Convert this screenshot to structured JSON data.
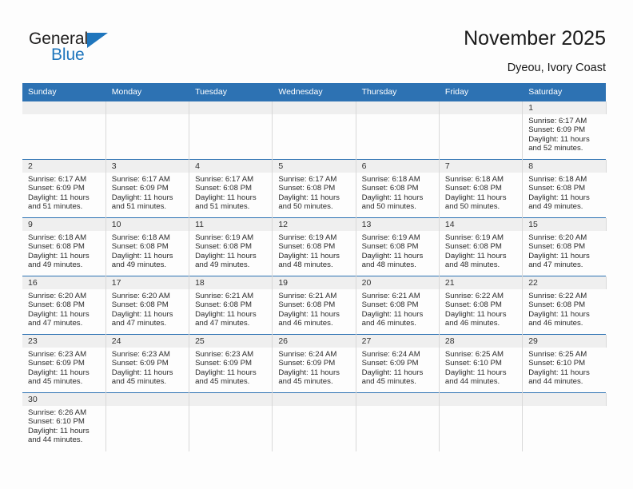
{
  "brand": {
    "name_part1": "General",
    "name_part2": "Blue",
    "accent_color": "#1f76bd",
    "triangle_icon": "logo-triangle-icon"
  },
  "header": {
    "title": "November 2025",
    "subtitle": "Dyeou, Ivory Coast"
  },
  "calendar": {
    "header_bg": "#2d72b3",
    "daynum_bg": "#efefef",
    "weekdays": [
      "Sunday",
      "Monday",
      "Tuesday",
      "Wednesday",
      "Thursday",
      "Friday",
      "Saturday"
    ],
    "labels": {
      "sunrise": "Sunrise:",
      "sunset": "Sunset:",
      "daylight": "Daylight:"
    },
    "weeks": [
      [
        {
          "day": "",
          "empty": true
        },
        {
          "day": "",
          "empty": true
        },
        {
          "day": "",
          "empty": true
        },
        {
          "day": "",
          "empty": true
        },
        {
          "day": "",
          "empty": true
        },
        {
          "day": "",
          "empty": true
        },
        {
          "day": "1",
          "sunrise": "Sunrise: 6:17 AM",
          "sunset": "Sunset: 6:09 PM",
          "daylight_l1": "Daylight: 11 hours",
          "daylight_l2": "and 52 minutes."
        }
      ],
      [
        {
          "day": "2",
          "sunrise": "Sunrise: 6:17 AM",
          "sunset": "Sunset: 6:09 PM",
          "daylight_l1": "Daylight: 11 hours",
          "daylight_l2": "and 51 minutes."
        },
        {
          "day": "3",
          "sunrise": "Sunrise: 6:17 AM",
          "sunset": "Sunset: 6:09 PM",
          "daylight_l1": "Daylight: 11 hours",
          "daylight_l2": "and 51 minutes."
        },
        {
          "day": "4",
          "sunrise": "Sunrise: 6:17 AM",
          "sunset": "Sunset: 6:08 PM",
          "daylight_l1": "Daylight: 11 hours",
          "daylight_l2": "and 51 minutes."
        },
        {
          "day": "5",
          "sunrise": "Sunrise: 6:17 AM",
          "sunset": "Sunset: 6:08 PM",
          "daylight_l1": "Daylight: 11 hours",
          "daylight_l2": "and 50 minutes."
        },
        {
          "day": "6",
          "sunrise": "Sunrise: 6:18 AM",
          "sunset": "Sunset: 6:08 PM",
          "daylight_l1": "Daylight: 11 hours",
          "daylight_l2": "and 50 minutes."
        },
        {
          "day": "7",
          "sunrise": "Sunrise: 6:18 AM",
          "sunset": "Sunset: 6:08 PM",
          "daylight_l1": "Daylight: 11 hours",
          "daylight_l2": "and 50 minutes."
        },
        {
          "day": "8",
          "sunrise": "Sunrise: 6:18 AM",
          "sunset": "Sunset: 6:08 PM",
          "daylight_l1": "Daylight: 11 hours",
          "daylight_l2": "and 49 minutes."
        }
      ],
      [
        {
          "day": "9",
          "sunrise": "Sunrise: 6:18 AM",
          "sunset": "Sunset: 6:08 PM",
          "daylight_l1": "Daylight: 11 hours",
          "daylight_l2": "and 49 minutes."
        },
        {
          "day": "10",
          "sunrise": "Sunrise: 6:18 AM",
          "sunset": "Sunset: 6:08 PM",
          "daylight_l1": "Daylight: 11 hours",
          "daylight_l2": "and 49 minutes."
        },
        {
          "day": "11",
          "sunrise": "Sunrise: 6:19 AM",
          "sunset": "Sunset: 6:08 PM",
          "daylight_l1": "Daylight: 11 hours",
          "daylight_l2": "and 49 minutes."
        },
        {
          "day": "12",
          "sunrise": "Sunrise: 6:19 AM",
          "sunset": "Sunset: 6:08 PM",
          "daylight_l1": "Daylight: 11 hours",
          "daylight_l2": "and 48 minutes."
        },
        {
          "day": "13",
          "sunrise": "Sunrise: 6:19 AM",
          "sunset": "Sunset: 6:08 PM",
          "daylight_l1": "Daylight: 11 hours",
          "daylight_l2": "and 48 minutes."
        },
        {
          "day": "14",
          "sunrise": "Sunrise: 6:19 AM",
          "sunset": "Sunset: 6:08 PM",
          "daylight_l1": "Daylight: 11 hours",
          "daylight_l2": "and 48 minutes."
        },
        {
          "day": "15",
          "sunrise": "Sunrise: 6:20 AM",
          "sunset": "Sunset: 6:08 PM",
          "daylight_l1": "Daylight: 11 hours",
          "daylight_l2": "and 47 minutes."
        }
      ],
      [
        {
          "day": "16",
          "sunrise": "Sunrise: 6:20 AM",
          "sunset": "Sunset: 6:08 PM",
          "daylight_l1": "Daylight: 11 hours",
          "daylight_l2": "and 47 minutes."
        },
        {
          "day": "17",
          "sunrise": "Sunrise: 6:20 AM",
          "sunset": "Sunset: 6:08 PM",
          "daylight_l1": "Daylight: 11 hours",
          "daylight_l2": "and 47 minutes."
        },
        {
          "day": "18",
          "sunrise": "Sunrise: 6:21 AM",
          "sunset": "Sunset: 6:08 PM",
          "daylight_l1": "Daylight: 11 hours",
          "daylight_l2": "and 47 minutes."
        },
        {
          "day": "19",
          "sunrise": "Sunrise: 6:21 AM",
          "sunset": "Sunset: 6:08 PM",
          "daylight_l1": "Daylight: 11 hours",
          "daylight_l2": "and 46 minutes."
        },
        {
          "day": "20",
          "sunrise": "Sunrise: 6:21 AM",
          "sunset": "Sunset: 6:08 PM",
          "daylight_l1": "Daylight: 11 hours",
          "daylight_l2": "and 46 minutes."
        },
        {
          "day": "21",
          "sunrise": "Sunrise: 6:22 AM",
          "sunset": "Sunset: 6:08 PM",
          "daylight_l1": "Daylight: 11 hours",
          "daylight_l2": "and 46 minutes."
        },
        {
          "day": "22",
          "sunrise": "Sunrise: 6:22 AM",
          "sunset": "Sunset: 6:08 PM",
          "daylight_l1": "Daylight: 11 hours",
          "daylight_l2": "and 46 minutes."
        }
      ],
      [
        {
          "day": "23",
          "sunrise": "Sunrise: 6:23 AM",
          "sunset": "Sunset: 6:09 PM",
          "daylight_l1": "Daylight: 11 hours",
          "daylight_l2": "and 45 minutes."
        },
        {
          "day": "24",
          "sunrise": "Sunrise: 6:23 AM",
          "sunset": "Sunset: 6:09 PM",
          "daylight_l1": "Daylight: 11 hours",
          "daylight_l2": "and 45 minutes."
        },
        {
          "day": "25",
          "sunrise": "Sunrise: 6:23 AM",
          "sunset": "Sunset: 6:09 PM",
          "daylight_l1": "Daylight: 11 hours",
          "daylight_l2": "and 45 minutes."
        },
        {
          "day": "26",
          "sunrise": "Sunrise: 6:24 AM",
          "sunset": "Sunset: 6:09 PM",
          "daylight_l1": "Daylight: 11 hours",
          "daylight_l2": "and 45 minutes."
        },
        {
          "day": "27",
          "sunrise": "Sunrise: 6:24 AM",
          "sunset": "Sunset: 6:09 PM",
          "daylight_l1": "Daylight: 11 hours",
          "daylight_l2": "and 45 minutes."
        },
        {
          "day": "28",
          "sunrise": "Sunrise: 6:25 AM",
          "sunset": "Sunset: 6:10 PM",
          "daylight_l1": "Daylight: 11 hours",
          "daylight_l2": "and 44 minutes."
        },
        {
          "day": "29",
          "sunrise": "Sunrise: 6:25 AM",
          "sunset": "Sunset: 6:10 PM",
          "daylight_l1": "Daylight: 11 hours",
          "daylight_l2": "and 44 minutes."
        }
      ],
      [
        {
          "day": "30",
          "sunrise": "Sunrise: 6:26 AM",
          "sunset": "Sunset: 6:10 PM",
          "daylight_l1": "Daylight: 11 hours",
          "daylight_l2": "and 44 minutes."
        },
        {
          "day": "",
          "empty": true
        },
        {
          "day": "",
          "empty": true
        },
        {
          "day": "",
          "empty": true
        },
        {
          "day": "",
          "empty": true
        },
        {
          "day": "",
          "empty": true
        },
        {
          "day": "",
          "empty": true
        }
      ]
    ]
  }
}
